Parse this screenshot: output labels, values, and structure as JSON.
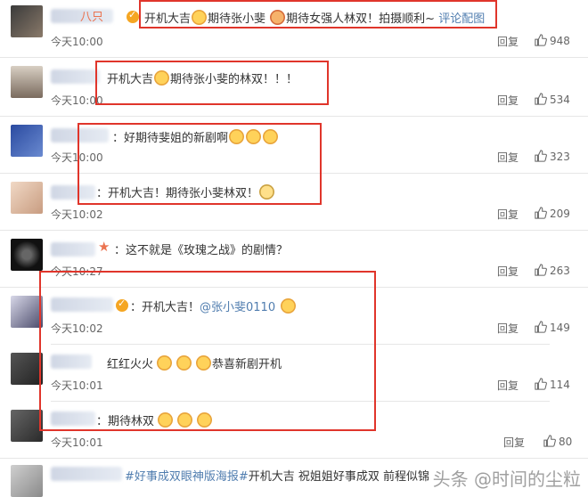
{
  "comments": [
    {
      "pre": "",
      "text": "开机大吉",
      "text2": "期待张小斐",
      "text3": "期待女强人林双！拍摄顺利~ ",
      "link": "评论配图",
      "time": "今天10:00",
      "reply": "回复",
      "likes": "948",
      "partial_name": "八只"
    },
    {
      "text": "开机大吉",
      "text2": "期待张小斐的林双！！！",
      "time": "今天10:00",
      "reply": "回复",
      "likes": "534"
    },
    {
      "text": "：好期待斐姐的新剧啊",
      "time": "今天10:00",
      "reply": "回复",
      "likes": "323"
    },
    {
      "text": "：开机大吉！期待张小斐林双！",
      "time": "今天10:02",
      "reply": "回复",
      "likes": "209"
    },
    {
      "text": "：这不就是《玫瑰之战》的剧情？",
      "time": "今天10:27",
      "reply": "回复",
      "likes": "263"
    },
    {
      "text": "：开机大吉！",
      "mention": "@张小斐0110",
      "time": "今天10:02",
      "reply": "回复",
      "likes": "149"
    },
    {
      "text": "红红火火",
      "text2": "恭喜新剧开机",
      "time": "今天10:01",
      "reply": "回复",
      "likes": "114"
    },
    {
      "text": "：期待林双",
      "time": "今天10:01",
      "reply": "回复",
      "likes": "80"
    },
    {
      "text_tag": "#好事成双眼神版海报#",
      "text": "开机大吉 祝姐姐好事成双 前程似锦"
    }
  ],
  "watermark": "头条 @时间的尘粒",
  "colors": {
    "accent": "#eb7350",
    "highlight_box": "#e0352b",
    "mention": "#507daf"
  }
}
